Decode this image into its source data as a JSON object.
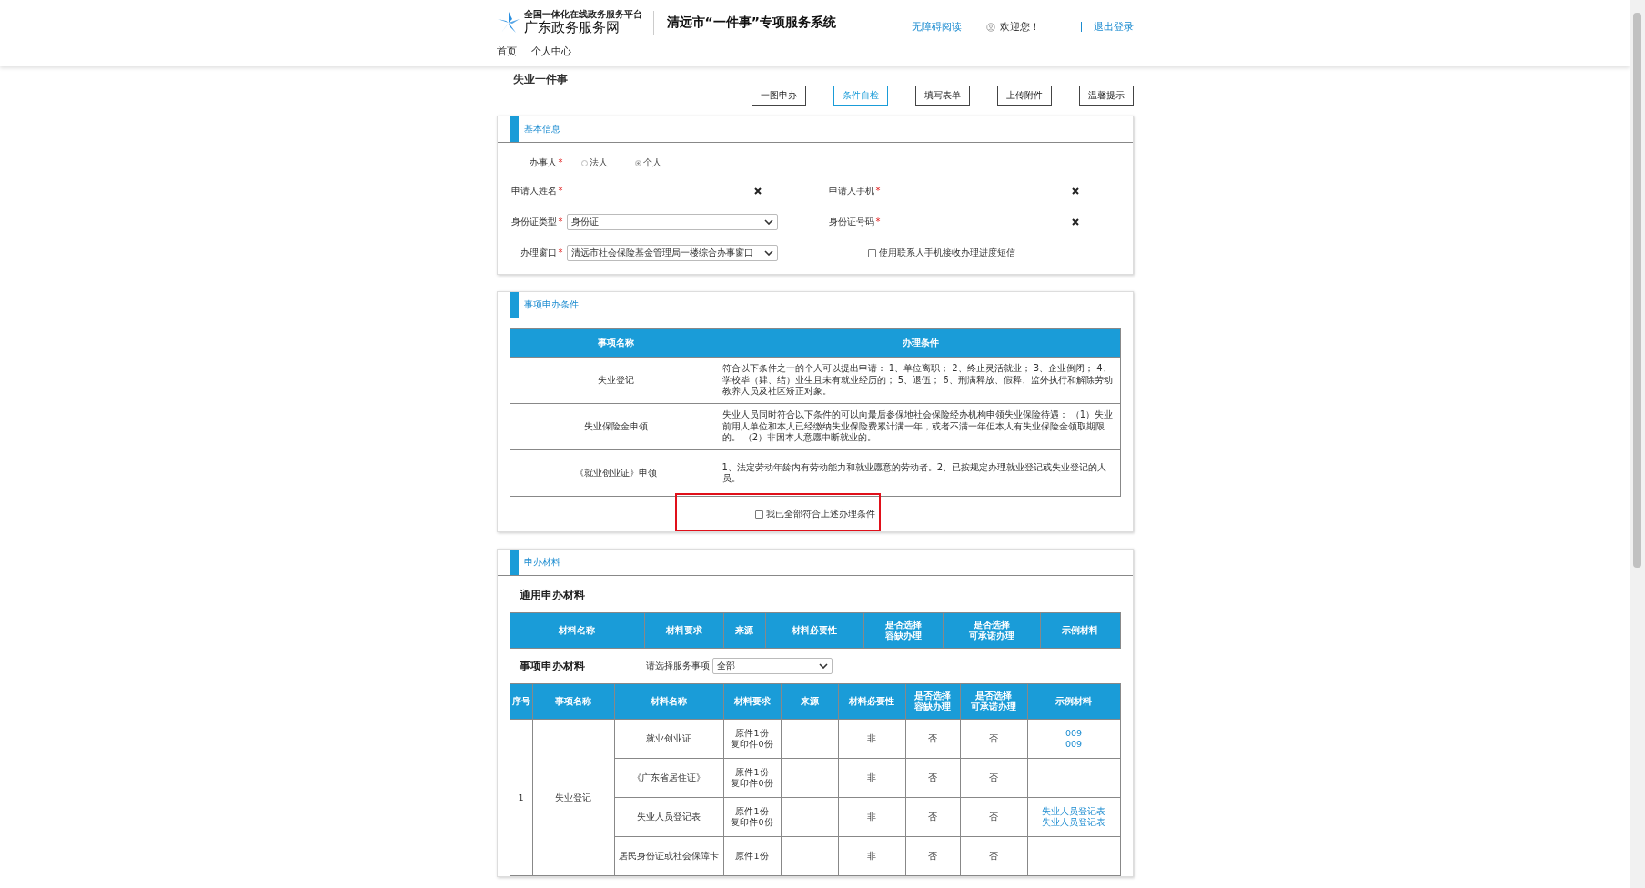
{
  "header": {
    "platform_tagline": "全国一体化在线政务服务平台",
    "site_name": "广东政务服务网",
    "system_title": "清远市“一件事”专项服务系统",
    "accessibility_link": "无障碍阅读",
    "welcome": "欢迎您！",
    "logout": "退出登录"
  },
  "nav": [
    {
      "label": "首页",
      "selected": false
    },
    {
      "label": "个人中心",
      "selected": false
    }
  ],
  "page_title": "失业一件事",
  "steps": [
    {
      "label": "一图申办",
      "selected": false
    },
    {
      "label": "条件自检",
      "selected": true
    },
    {
      "label": "填写表单",
      "selected": false
    },
    {
      "label": "上传附件",
      "selected": false
    },
    {
      "label": "温馨提示",
      "selected": false
    }
  ],
  "basic_info": {
    "title": "基本信息",
    "applicant_type": {
      "label": "办事人",
      "mark": "*",
      "options": [
        {
          "label": "法人",
          "selected": false
        },
        {
          "label": "个人",
          "selected": true
        }
      ]
    },
    "fields": [
      {
        "kind": "text",
        "label": "申请人姓名",
        "mark": "*"
      },
      {
        "kind": "text",
        "label": "申请人手机",
        "mark": "*"
      },
      {
        "kind": "select",
        "label": "身份证类型",
        "mark": "*",
        "value": "身份证"
      },
      {
        "kind": "text",
        "label": "身份证号码",
        "mark": "*"
      },
      {
        "kind": "select",
        "label": "办理窗口",
        "mark": "*",
        "value": "清远市社会保险基金管理局一楼综合办事窗口"
      },
      {
        "kind": "checkbox",
        "label": "使用联系人手机接收办理进度短信",
        "checked": false
      }
    ]
  },
  "conditions": {
    "title": "事项申办条件",
    "columns": [
      "事项名称",
      "办理条件"
    ],
    "rows": [
      {
        "name": "失业登记",
        "condition": "符合以下条件之一的个人可以提出申请： 1、单位离职； 2、终止灵活就业； 3、企业倒闭； 4、学校毕（肄、结）业生且未有就业经历的； 5、退伍； 6、刑满释放、假释、监外执行和解除劳动教养人员及社区矫正对象。"
      },
      {
        "name": "失业保险金申领",
        "condition": "失业人员同时符合以下条件的可以向最后参保地社会保险经办机构申领失业保险待遇：\n（1）失业前用人单位和本人已经缴纳失业保险费累计满一年，或者不满一年但本人有失业保险金领取期限的。 （2）非因本人意愿中断就业的。"
      },
      {
        "name": "《就业创业证》申领",
        "condition": "1、法定劳动年龄内有劳动能力和就业愿意的劳动者。2、已按规定办理就业登记或失业登记的人员。"
      }
    ],
    "confirm": {
      "label": "我已全部符合上述办理条件",
      "checked": false
    }
  },
  "materials": {
    "title": "申办材料",
    "general": {
      "heading": "通用申办材料",
      "columns": [
        [
          "材料名称"
        ],
        [
          "材料要求"
        ],
        [
          "来源"
        ],
        [
          "材料必要性"
        ],
        [
          "是否选择",
          "容缺办理"
        ],
        [
          "是否选择",
          "可承诺办理"
        ],
        [
          "示例材料"
        ]
      ]
    },
    "specific": {
      "heading": "事项申办材料",
      "filter_label": "请选择服务事项",
      "filter_value": "全部",
      "columns": [
        [
          "序号"
        ],
        [
          "事项名称"
        ],
        [
          "材料名称"
        ],
        [
          "材料要求"
        ],
        [
          "来源"
        ],
        [
          "材料必要性"
        ],
        [
          "是否选择",
          "容缺办理"
        ],
        [
          "是否选择",
          "可承诺办理"
        ],
        [
          "示例材料"
        ]
      ],
      "groups": [
        {
          "index": "1",
          "name": "失业登记",
          "items": [
            {
              "name": "就业创业证",
              "requirement": [
                "原件1份",
                "复印件0份"
              ],
              "necessity": "非",
              "fault_tolerant": "否",
              "promise": "否",
              "examples": [
                "009",
                "009"
              ]
            },
            {
              "name": "《广东省居住证》",
              "requirement": [
                "原件1份",
                "复印件0份"
              ],
              "necessity": "非",
              "fault_tolerant": "否",
              "promise": "否"
            },
            {
              "name": "失业人员登记表",
              "requirement": [
                "原件1份",
                "复印件0份"
              ],
              "necessity": "非",
              "fault_tolerant": "否",
              "promise": "否",
              "examples": [
                "失业人员登记表",
                "失业人员登记表"
              ]
            },
            {
              "name": "居民身份证或社会保障卡",
              "requirement": [
                "原件1份"
              ],
              "necessity": "非",
              "fault_tolerant": "否",
              "promise": "否"
            }
          ]
        }
      ]
    }
  }
}
